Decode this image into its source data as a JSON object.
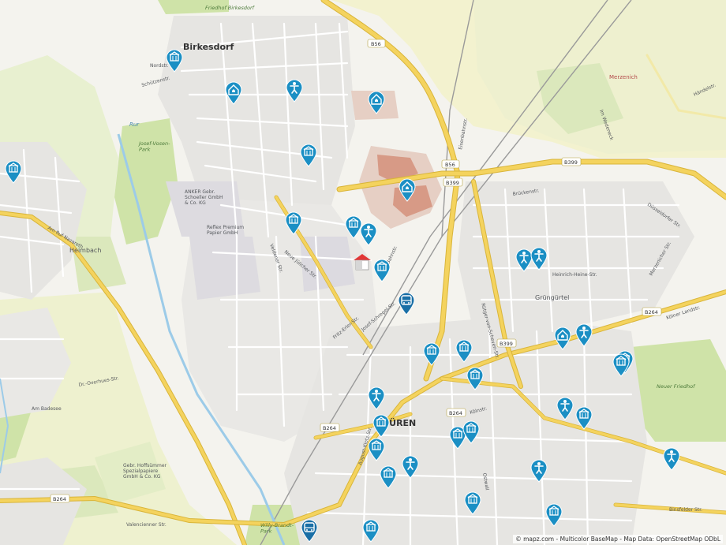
{
  "map": {
    "places": {
      "birkesdorf": "Birkesdorf",
      "dueren": "DÜREN",
      "merzenich": "Merzenich",
      "heimbach": "Heimbach",
      "gruengurtel": "Grüngürtel"
    },
    "green_labels": {
      "friedhof_birkesdorf": "Friedhof Birkesdorf",
      "josef_vosen_park": "Josef-Vosen-\nPark",
      "neuer_friedhof": "Neuer Friedhof",
      "willy_brandt_park": "Willy-Brandt-\nPark"
    },
    "water_labels": {
      "rur": "Rur"
    },
    "poi_labels": {
      "anker": "ANKER Gebr.\nSchoeller GmbH\n& Co. KG",
      "reflex": "Reflex Premium\nPapier GmbH",
      "gebr_hoffsuemmer": "Gebr. Hoffsümmer\nSpezialpapiere\nGmbH & Co. KG"
    },
    "road_shields": [
      "B56",
      "B56",
      "B399",
      "B399",
      "B264",
      "B264",
      "B264",
      "B399",
      "B264"
    ],
    "streets": [
      "Schützenstr.",
      "Nordstr.",
      "Am Ruf Nazareth",
      "Fritz-Erler-Str.",
      "Josef-Schregel-Str.",
      "Kölner Landstr.",
      "Valencienner Str.",
      "Binsfelder Str.",
      "Merzenicher Str.",
      "Düsseldorfer Str.",
      "Händelstr.",
      "August-Klotz-Str.",
      "Neue Jülicher Str.",
      "Veldener Str.",
      "Bahnstr.",
      "Am Badesee",
      "Dr.-Overhues-Str.",
      "Ostwall",
      "Brückenstr.",
      "Eisenbahnstr.",
      "Kölnstr.",
      "Rütger-von-Scheven-Str.",
      "Heinrich-Heine-Str.",
      "Im Wedeneck"
    ],
    "attribution": "© mapz.com - Multicolor BaseMap - Map Data: OpenStreetMap ODbL"
  },
  "markers": {
    "legend_icons": [
      "nursing-home-icon",
      "senior-residence-icon",
      "care-service-icon",
      "bus-station-icon",
      "location-house-icon"
    ],
    "colors": {
      "pin": "#1b8fc4",
      "bus": "#1a6fa6",
      "location": "#e23636",
      "road_yellow": "#f4d35e",
      "road_outline": "#d9b53a",
      "green": "#d7e6b5",
      "water": "#9ccbe8"
    },
    "types": {
      "building": "nursing-home-icon",
      "person": "care-service-icon",
      "house": "senior-residence-icon",
      "bus": "bus-station-icon",
      "location": "location-house-icon"
    }
  }
}
